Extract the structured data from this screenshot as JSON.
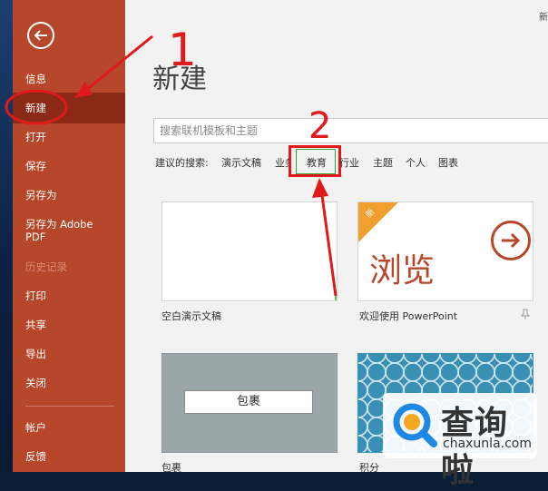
{
  "sidebar": {
    "items": [
      {
        "id": "info",
        "label": "信息"
      },
      {
        "id": "new",
        "label": "新建"
      },
      {
        "id": "open",
        "label": "打开"
      },
      {
        "id": "save",
        "label": "保存"
      },
      {
        "id": "saveas",
        "label": "另存为"
      },
      {
        "id": "saveas-adobe",
        "label": "另存为 Adobe PDF"
      },
      {
        "id": "history",
        "label": "历史记录"
      },
      {
        "id": "print",
        "label": "打印"
      },
      {
        "id": "share",
        "label": "共享"
      },
      {
        "id": "export",
        "label": "导出"
      },
      {
        "id": "close",
        "label": "关闭"
      },
      {
        "id": "account",
        "label": "帐户"
      },
      {
        "id": "feedback",
        "label": "反馈"
      }
    ]
  },
  "main": {
    "corner_text": "新",
    "title": "新建",
    "search": {
      "placeholder": "搜索联机模板和主题"
    },
    "suggested": {
      "label": "建议的搜索:",
      "items": [
        "演示文稿",
        "业务",
        "教育",
        "行业",
        "主题",
        "个人",
        "图表"
      ]
    },
    "templates": {
      "blank": {
        "caption": "空白演示文稿"
      },
      "welcome": {
        "caption": "欢迎使用 PowerPoint",
        "badge": "新",
        "art_text": "浏览"
      },
      "wrap": {
        "caption": "包裹",
        "button_text": "包裹"
      },
      "points": {
        "caption": "积分"
      }
    }
  },
  "annotations": {
    "marker1": "1",
    "marker2": "2"
  },
  "watermark": {
    "text": "查询啦",
    "url": "chaxunla.com"
  },
  "colors": {
    "accent": "#b7472a",
    "highlight": "#e01a1a"
  }
}
